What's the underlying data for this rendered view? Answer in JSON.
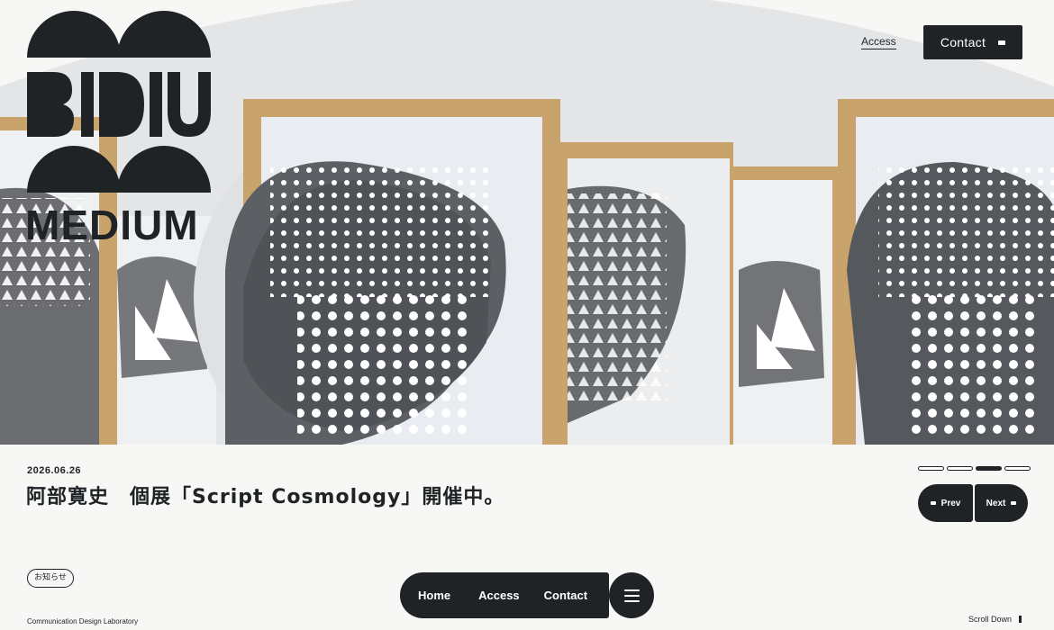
{
  "brand": {
    "logo_text": "MEDIUM",
    "tagline": "Communication Design Laboratory"
  },
  "header": {
    "access_label": "Access",
    "contact_label": "Contact"
  },
  "news": {
    "date": "2026.06.26",
    "title": "阿部寛史　個展「Script Cosmology」開催中。",
    "category": "お知らせ"
  },
  "slider": {
    "slide_count": 4,
    "active_index": 2,
    "prev_label": "Prev",
    "next_label": "Next"
  },
  "floating_nav": {
    "items": [
      "Home",
      "Access",
      "Contact"
    ]
  },
  "scroll_label": "Scroll Down",
  "colors": {
    "dark": "#1f2326",
    "background": "#f7f7f5",
    "frame": "#c9a36c"
  },
  "icons": {
    "arrow": "arrow-right-icon",
    "menu": "hamburger-icon"
  }
}
